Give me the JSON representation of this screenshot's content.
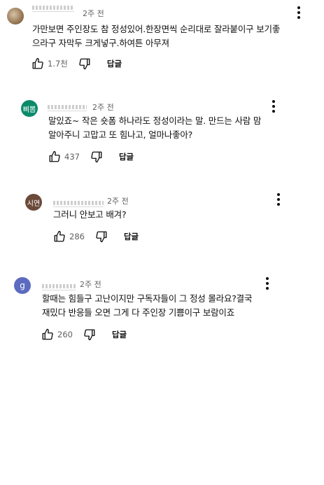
{
  "comments": [
    {
      "avatar_text": "",
      "avatar_color": "#8b6b4a",
      "time": "2주 전",
      "lines": [
        "가만보면 주인장도 참 정성있어.한장면씩 순리대로 잘라붙이구 보기좋",
        "으라구 자막두 크게넣구.하여튼 아무져"
      ],
      "likes": "1.7천",
      "reply_label": "답글"
    },
    {
      "avatar_text": "삐뽑",
      "avatar_color": "#0b8a6a",
      "time": "2주 전",
      "lines": [
        "말있죠~ 작은 숏폼 하나라도 정성이라는 말. 만드는 사람 맘",
        "알아주니 고맙고 또 힘나고, 얼마나좋아?"
      ],
      "likes": "437",
      "reply_label": "답글"
    },
    {
      "avatar_text": "시연",
      "avatar_color": "#6b4a3a",
      "time": "2주 전",
      "lines": [
        "그러니 안보고 배겨?"
      ],
      "likes": "286",
      "reply_label": "답글"
    },
    {
      "avatar_text": "g",
      "avatar_color": "#5c6bc0",
      "time": "2주 전",
      "lines": [
        "할때는 힘들구 고난이지만 구독자들이 그 정성 몰라요?결국",
        "재밌다 반응들 오면 그게 다 주인장 기쁨이구 보람이죠"
      ],
      "likes": "260",
      "reply_label": "답글"
    }
  ],
  "icons": {
    "like": "thumbs-up-icon",
    "dislike": "thumbs-down-icon",
    "menu": "more-vert-icon"
  }
}
